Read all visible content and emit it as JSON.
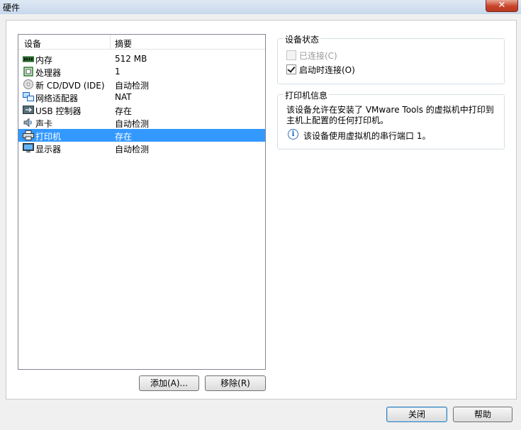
{
  "window": {
    "title": "硬件",
    "close_glyph": "✕"
  },
  "device_list": {
    "columns": [
      "设备",
      "摘要"
    ],
    "rows": [
      {
        "name": "内存",
        "summary": "512 MB",
        "icon": "memory-icon"
      },
      {
        "name": "处理器",
        "summary": "1",
        "icon": "processor-icon"
      },
      {
        "name": "新 CD/DVD (IDE)",
        "summary": "自动检测",
        "icon": "cd-dvd-icon"
      },
      {
        "name": "网络适配器",
        "summary": "NAT",
        "icon": "network-adapter-icon"
      },
      {
        "name": "USB 控制器",
        "summary": "存在",
        "icon": "usb-icon"
      },
      {
        "name": "声卡",
        "summary": "自动检测",
        "icon": "sound-card-icon"
      },
      {
        "name": "打印机",
        "summary": "存在",
        "icon": "printer-icon",
        "selected": true
      },
      {
        "name": "显示器",
        "summary": "自动检测",
        "icon": "display-icon"
      }
    ]
  },
  "buttons": {
    "add": "添加(A)...",
    "remove": "移除(R)",
    "close": "关闭",
    "help": "帮助"
  },
  "device_status": {
    "title": "设备状态",
    "connected": {
      "label": "已连接(C)",
      "checked": false,
      "disabled": true
    },
    "connect_at_power_on": {
      "label": "启动时连接(O)",
      "checked": true,
      "disabled": false
    }
  },
  "printer_info": {
    "title": "打印机信息",
    "description": "该设备允许在安装了 VMware Tools 的虚拟机中打印到主机上配置的任何打印机。",
    "note": "该设备使用虚拟机的串行端口 1。"
  },
  "colors": {
    "selection": "#3399ff",
    "close_button": "#c7432a"
  }
}
